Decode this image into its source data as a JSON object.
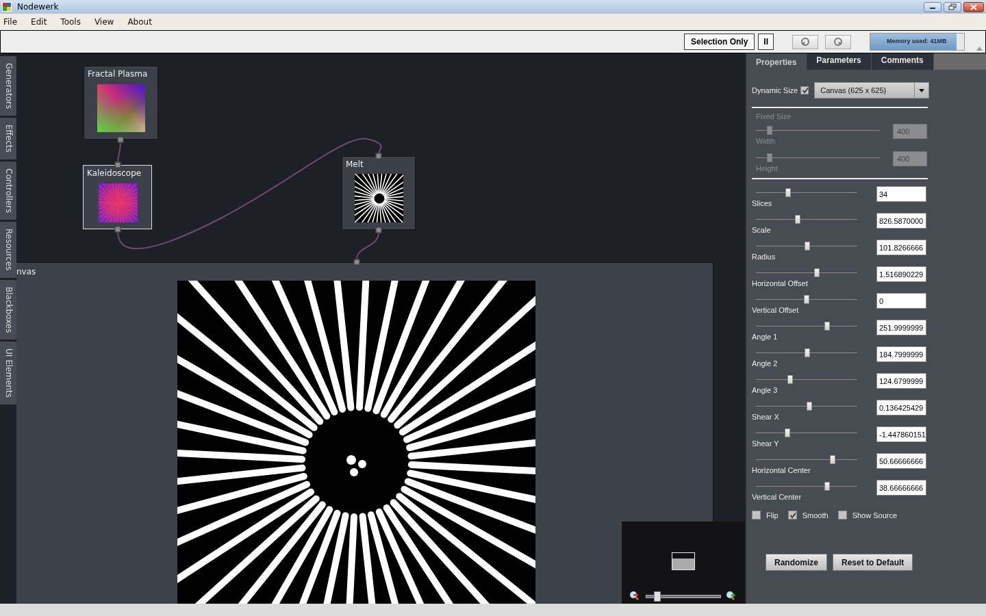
{
  "window": {
    "title": "Nodewerk"
  },
  "menu": [
    "File",
    "Edit",
    "Tools",
    "View",
    "About"
  ],
  "toolbar": {
    "selection_only": "Selection Only",
    "pause": "II",
    "memory": {
      "text": "Memory used: 41MB",
      "level": 0.92
    }
  },
  "side_tabs": [
    "Generators",
    "Effects",
    "Controllers",
    "Resources",
    "Blackboxes",
    "UI Elements"
  ],
  "graph": {
    "nodes": [
      {
        "title": "Fractal Plasma",
        "kind": "plasma",
        "selected": false
      },
      {
        "title": "Kaleidoscope",
        "kind": "kaleidoscope",
        "selected": true
      },
      {
        "title": "Melt",
        "kind": "melt",
        "selected": false
      }
    ]
  },
  "canvas_panel": {
    "title": "nvas",
    "navigator": {
      "level": 0.15
    }
  },
  "properties": {
    "tabs": [
      {
        "label": "Properties",
        "selected": true
      },
      {
        "label": "Parameters",
        "selected": false
      },
      {
        "label": "Comments",
        "selected": false
      }
    ],
    "dynamic_size": {
      "label": "Dynamic Size",
      "checked": true,
      "dropdown": "Canvas (625 x 625)"
    },
    "fixed_size": {
      "title": "Fixed Size",
      "disabled": true,
      "rows": [
        {
          "label": "Width",
          "value": "400",
          "level": 0.11
        },
        {
          "label": "Height",
          "value": "400",
          "level": 0.11
        }
      ]
    },
    "parameters": [
      {
        "label": "Slices",
        "value": "34",
        "level": 0.32
      },
      {
        "label": "Scale",
        "value": "826.5870000",
        "level": 0.41
      },
      {
        "label": "Radius",
        "value": "101.8266666",
        "level": 0.51
      },
      {
        "label": "Horizontal Offset",
        "value": "1.516890229",
        "level": 0.6
      },
      {
        "label": "Vertical Offset",
        "value": "0",
        "level": 0.5
      },
      {
        "label": "Angle 1",
        "value": "251.9999999",
        "level": 0.7
      },
      {
        "label": "Angle 2",
        "value": "184.7999999",
        "level": 0.51
      },
      {
        "label": "Angle 3",
        "value": "124.6799999",
        "level": 0.34
      },
      {
        "label": "Shear X",
        "value": "0.136425429",
        "level": 0.53
      },
      {
        "label": "Shear Y",
        "value": "-1.447860151",
        "level": 0.31
      },
      {
        "label": "Horizontal Center",
        "value": "50.66666666",
        "level": 0.76
      },
      {
        "label": "Vertical Center",
        "value": "38.66666666",
        "level": 0.7
      }
    ],
    "options": [
      {
        "label": "Flip",
        "checked": false
      },
      {
        "label": "Smooth",
        "checked": true
      },
      {
        "label": "Show Source",
        "checked": false
      }
    ],
    "buttons": [
      "Randomize",
      "Reset to Default"
    ]
  }
}
